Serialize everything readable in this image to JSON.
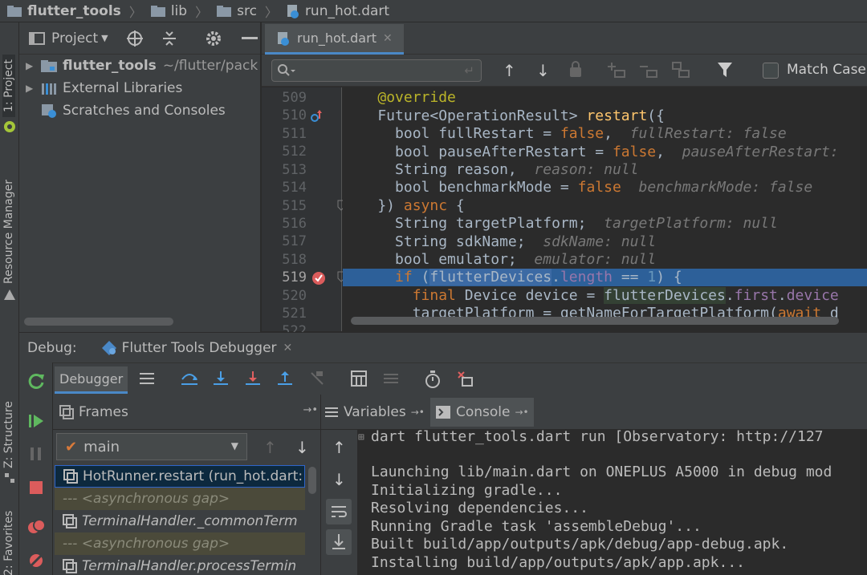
{
  "navbar": {
    "crumbs": [
      "flutter_tools",
      "lib",
      "src",
      "run_hot.dart"
    ]
  },
  "left_strip": {
    "project_tab": "1: Project",
    "resource_tab": "Resource Manager",
    "structure_tab": "Z: Structure",
    "favorites_tab": "2: Favorites"
  },
  "project": {
    "title": "Project",
    "tree": [
      {
        "label": "flutter_tools",
        "extra": "~/flutter/pack",
        "icon": "folder-module-icon"
      },
      {
        "label": "External Libraries",
        "extra": "",
        "icon": "library-icon"
      },
      {
        "label": "Scratches and Consoles",
        "extra": "",
        "icon": "scratch-icon"
      }
    ]
  },
  "editor": {
    "tab_label": "run_hot.dart",
    "search_placeholder": "",
    "match_case_label": "Match Case",
    "line_numbers": [
      "509",
      "510",
      "511",
      "512",
      "513",
      "514",
      "515",
      "516",
      "517",
      "518",
      "519",
      "520",
      "521",
      "522"
    ]
  },
  "debug": {
    "label": "Debug:",
    "session_tab": "Flutter Tools Debugger",
    "debugger_tab": "Debugger",
    "frames_label": "Frames",
    "variables_label": "Variables",
    "console_label": "Console",
    "thread": "main",
    "frames": [
      {
        "text": "HotRunner.restart (run_hot.dart:",
        "kind": "frame"
      },
      {
        "text": "--- <asynchronous gap>",
        "kind": "gap"
      },
      {
        "text": "TerminalHandler._commonTerm",
        "kind": "frame"
      },
      {
        "text": "--- <asynchronous gap>",
        "kind": "gap"
      },
      {
        "text": "TerminalHandler.processTermin",
        "kind": "frame"
      }
    ],
    "console_lines": [
      "dart flutter_tools.dart run [Observatory: http://127",
      "",
      "Launching lib/main.dart on ONEPLUS A5000 in debug mod",
      "Initializing gradle...",
      "Resolving dependencies...",
      "Running Gradle task 'assembleDebug'...",
      "Built build/app/outputs/apk/debug/app-debug.apk.",
      "Installing build/app/outputs/apk/app.apk..."
    ]
  },
  "colors": {
    "keyword": "#cc7832",
    "function": "#ffc66d",
    "annotation": "#bbb529",
    "number": "#6897bb",
    "hint": "#787878",
    "selection": "#2d6099"
  }
}
